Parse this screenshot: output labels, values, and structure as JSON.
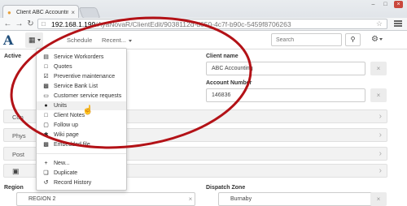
{
  "browser": {
    "tab_title": "Client ABC Accounting",
    "tab_close": "×",
    "url_host": "192.168.1.199",
    "url_path": "/AyaNovaR/ClientEdit/9038112d-d650-4c7f-b90c-5459f8706263",
    "window_buttons": [
      "–",
      "□",
      "×"
    ]
  },
  "appbar": {
    "logo": "A",
    "schedule": "Schedule",
    "recent": "Recent...",
    "search_placeholder": "Search"
  },
  "form": {
    "active_label": "Active",
    "client_name_label": "Client name",
    "client_name_value": "ABC Accounting",
    "account_number_label": "Account Number",
    "account_number_value": "146836",
    "panels": [
      "Con",
      "Phys",
      "Post"
    ],
    "region_label": "Region",
    "region_value": "REGION 2",
    "dispatch_zone_label": "Dispatch Zone",
    "dispatch_zone_value": "Burnaby",
    "clear_glyph": "×"
  },
  "dropdown": {
    "groups": [
      [
        {
          "label": "Service Workorders",
          "icon": "clipboard-icon"
        },
        {
          "label": "Quotes",
          "icon": "document-icon"
        },
        {
          "label": "Preventive maintenance",
          "icon": "checkbox-icon"
        },
        {
          "label": "Service Bank List",
          "icon": "bus-icon"
        },
        {
          "label": "Customer service requests",
          "icon": "laptop-icon"
        },
        {
          "label": "Units",
          "icon": "dot-icon"
        },
        {
          "label": "Client Notes",
          "icon": "note-icon"
        },
        {
          "label": "Follow up",
          "icon": "followup-icon"
        },
        {
          "label": "Wiki page",
          "icon": "asterisk-icon"
        },
        {
          "label": "Embedded file",
          "icon": "image-icon"
        }
      ],
      [
        {
          "label": "New...",
          "icon": "plus-icon"
        },
        {
          "label": "Duplicate",
          "icon": "duplicate-icon"
        },
        {
          "label": "Record History",
          "icon": "history-icon"
        }
      ]
    ]
  },
  "colors": {
    "annotation": "#b31217",
    "logo": "#1f4d7a",
    "close_button": "#c9473c"
  }
}
